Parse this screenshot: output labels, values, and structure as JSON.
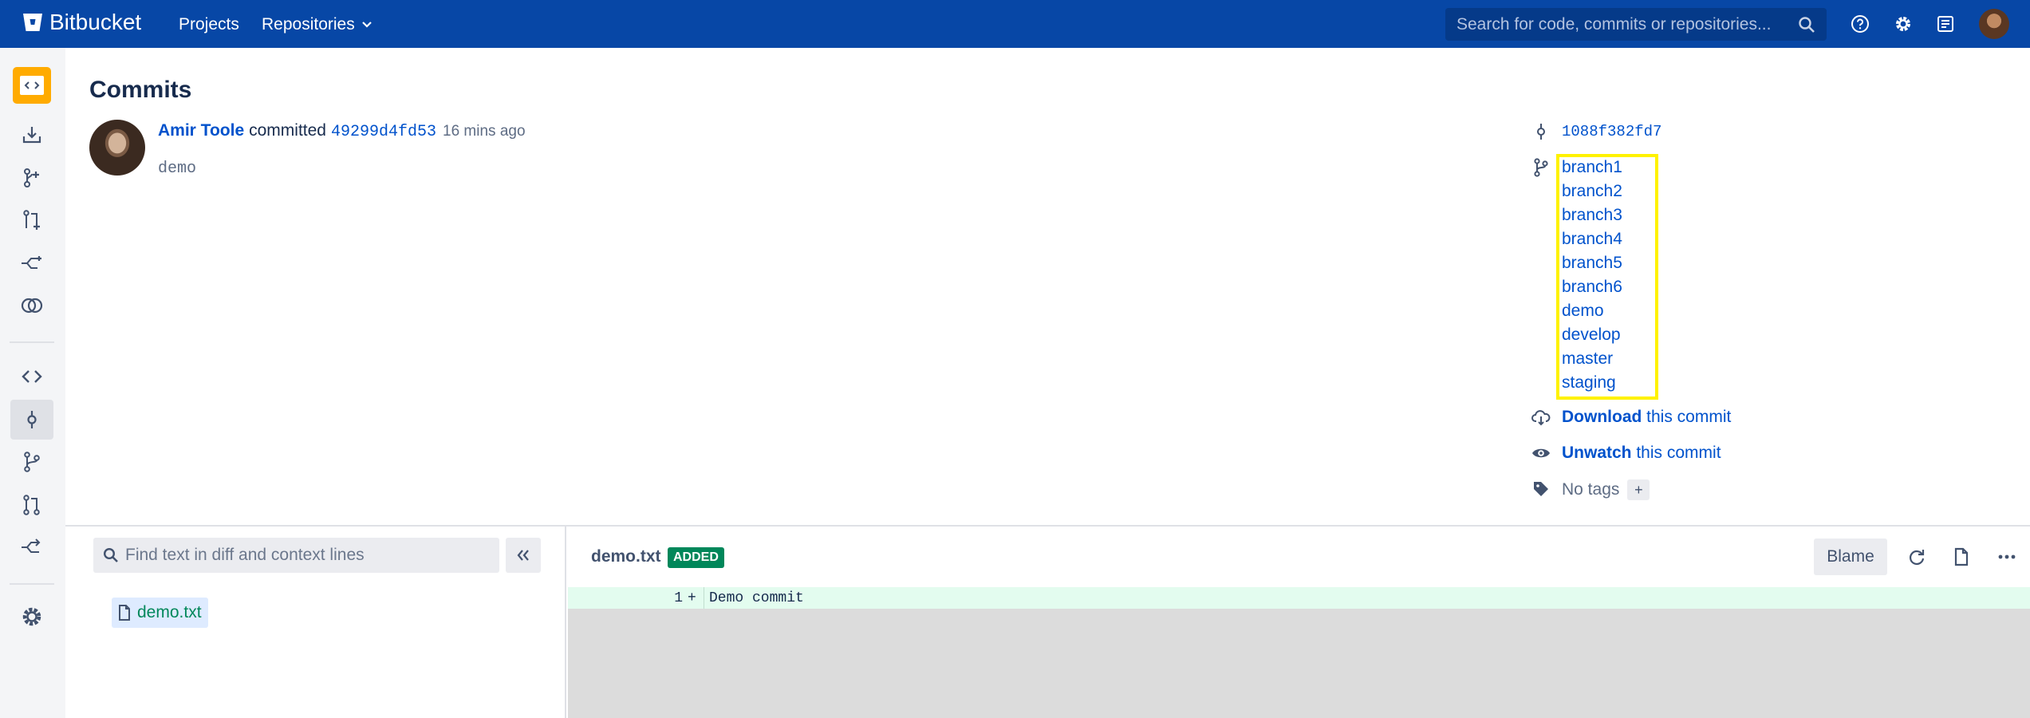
{
  "topbar": {
    "brand": "Bitbucket",
    "nav": {
      "projects": "Projects",
      "repositories": "Repositories"
    },
    "search_placeholder": "Search for code, commits or repositories..."
  },
  "page": {
    "title": "Commits"
  },
  "commit": {
    "author": "Amir Toole",
    "verb": "committed",
    "hash": "49299d4fd53",
    "time": "16 mins ago",
    "message": "demo"
  },
  "meta": {
    "parent_hash": "1088f382fd7",
    "branches": [
      "branch1",
      "branch2",
      "branch3",
      "branch4",
      "branch5",
      "branch6",
      "demo",
      "develop",
      "master",
      "staging"
    ],
    "download": {
      "strong": "Download",
      "rest": " this commit"
    },
    "unwatch": {
      "strong": "Unwatch",
      "rest": " this commit"
    },
    "no_tags": "No tags",
    "add_tag": "+"
  },
  "file_tree": {
    "search_placeholder": "Find text in diff and context lines",
    "files": [
      "demo.txt"
    ]
  },
  "diff": {
    "file_name": "demo.txt",
    "badge": "ADDED",
    "blame_label": "Blame",
    "lines": [
      {
        "number": "1",
        "marker": "+",
        "text": "Demo commit"
      }
    ]
  },
  "colors": {
    "nav_bg": "#0747a6",
    "link": "#0052cc",
    "added": "#00875a",
    "highlight": "#fff200"
  }
}
